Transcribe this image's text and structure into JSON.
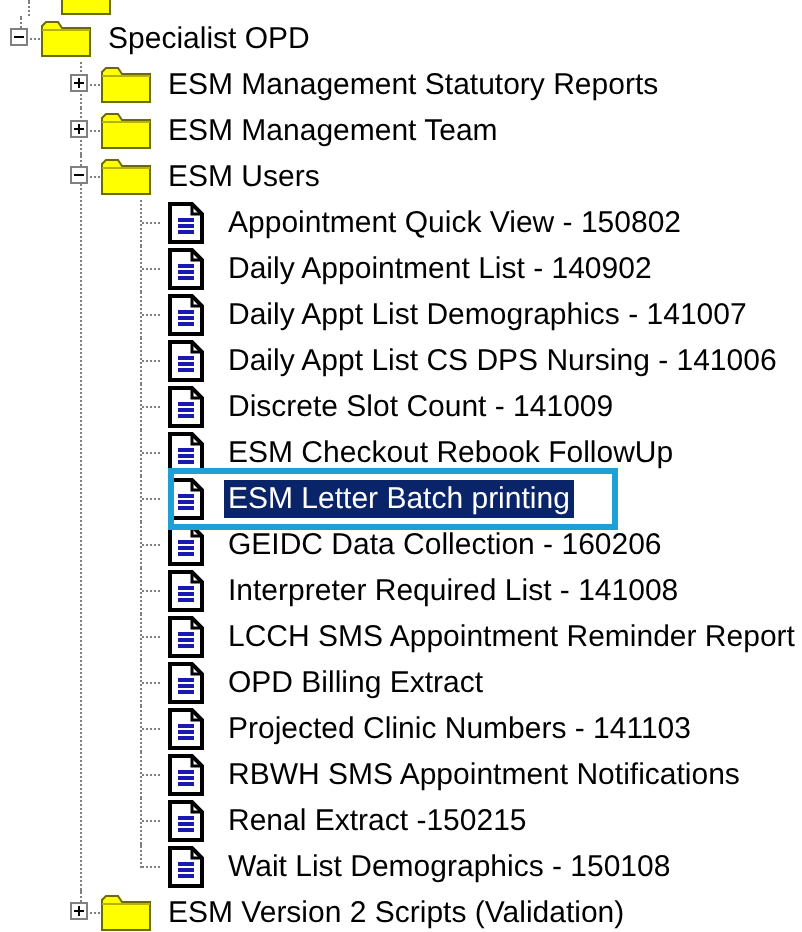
{
  "tree": [
    {
      "kind": "folder",
      "label": "Specialist OPD",
      "expanded": true,
      "children": [
        {
          "kind": "folder",
          "label": "ESM Management Statutory Reports",
          "expanded": false
        },
        {
          "kind": "folder",
          "label": "ESM Management Team",
          "expanded": false
        },
        {
          "kind": "folder",
          "label": "ESM Users",
          "expanded": true,
          "children": [
            {
              "kind": "report",
              "label": "Appointment Quick View - 150802",
              "selected": false,
              "outlined": false
            },
            {
              "kind": "report",
              "label": "Daily Appointment List - 140902",
              "selected": false,
              "outlined": false
            },
            {
              "kind": "report",
              "label": "Daily Appt List  Demographics - 141007",
              "selected": false,
              "outlined": false
            },
            {
              "kind": "report",
              "label": "Daily Appt List CS DPS Nursing - 141006",
              "selected": false,
              "outlined": false
            },
            {
              "kind": "report",
              "label": "Discrete Slot Count - 141009",
              "selected": false,
              "outlined": false
            },
            {
              "kind": "report",
              "label": "ESM Checkout Rebook FollowUp",
              "selected": false,
              "outlined": false
            },
            {
              "kind": "report",
              "label": "ESM Letter Batch printing",
              "selected": true,
              "outlined": true
            },
            {
              "kind": "report",
              "label": "GEIDC Data Collection - 160206",
              "selected": false,
              "outlined": false
            },
            {
              "kind": "report",
              "label": "Interpreter Required List - 141008",
              "selected": false,
              "outlined": false
            },
            {
              "kind": "report",
              "label": "LCCH SMS Appointment Reminder Report",
              "selected": false,
              "outlined": false
            },
            {
              "kind": "report",
              "label": "OPD Billing Extract",
              "selected": false,
              "outlined": false
            },
            {
              "kind": "report",
              "label": "Projected Clinic Numbers - 141103",
              "selected": false,
              "outlined": false
            },
            {
              "kind": "report",
              "label": "RBWH SMS Appointment Notifications",
              "selected": false,
              "outlined": false
            },
            {
              "kind": "report",
              "label": "Renal Extract -150215",
              "selected": false,
              "outlined": false
            },
            {
              "kind": "report",
              "label": "Wait List Demographics - 150108",
              "selected": false,
              "outlined": false
            }
          ]
        },
        {
          "kind": "folder",
          "label": "ESM Version 2 Scripts (Validation)",
          "expanded": false
        }
      ]
    }
  ]
}
